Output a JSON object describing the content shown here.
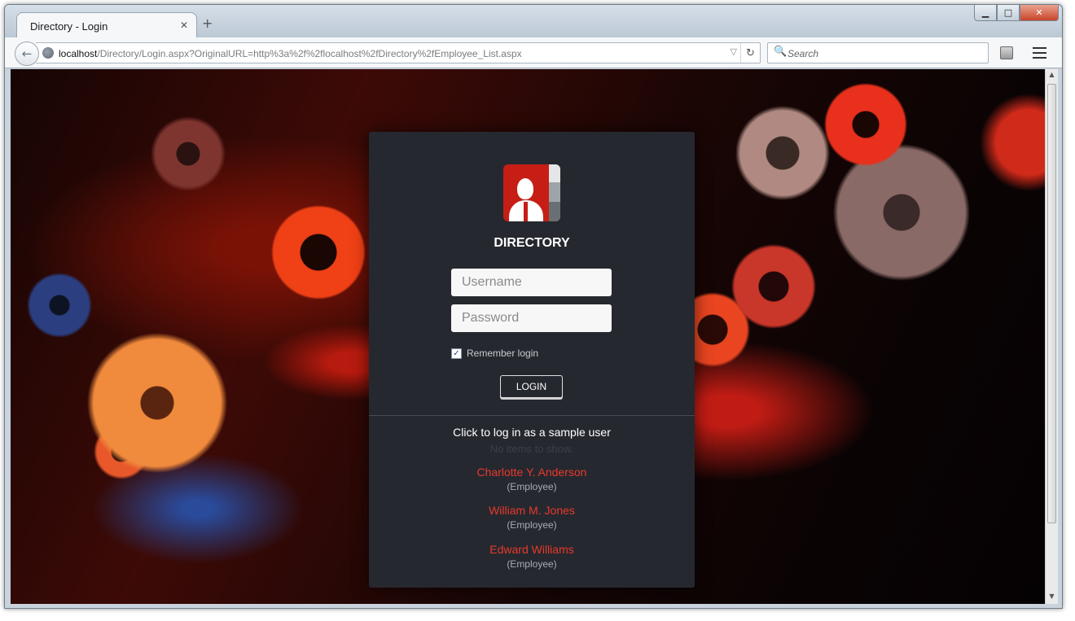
{
  "browser": {
    "tab": {
      "title": "Directory - Login",
      "close": "✕"
    },
    "new_tab": "+",
    "window_controls": {
      "minimize": "▁",
      "maximize": "□",
      "close": "✕"
    },
    "nav": {
      "back": "←",
      "url_host": "localhost",
      "url_path": "/Directory/Login.aspx?OriginalURL=http%3a%2f%2flocalhost%2fDirectory%2fEmployee_List.aspx",
      "dropdown": "▽",
      "reload": "↻",
      "search_placeholder": "Search",
      "search_icon": "🔍"
    },
    "scrollbar": {
      "up": "▲",
      "down": "▼",
      "grip": "≡"
    }
  },
  "login": {
    "app_title": "DIRECTORY",
    "username_placeholder": "Username",
    "password_placeholder": "Password",
    "remember_checked": true,
    "remember_check_mark": "✓",
    "remember_label": "Remember login",
    "login_button": "LOGIN",
    "sample_header": "Click to log in as a sample user",
    "no_items_text": "No items to show.",
    "sample_users": [
      {
        "name": "Charlotte Y. Anderson",
        "role": "(Employee)"
      },
      {
        "name": "William M. Jones",
        "role": "(Employee)"
      },
      {
        "name": "Edward Williams",
        "role": "(Employee)"
      }
    ]
  },
  "colors": {
    "panel_bg": "#262830",
    "accent_red": "#e8392a",
    "text_white": "#ffffff"
  },
  "icons": [
    "back-arrow-icon",
    "globe-icon",
    "reload-icon",
    "search-icon",
    "notepad-icon",
    "hamburger-menu-icon",
    "directory-logo-icon"
  ]
}
